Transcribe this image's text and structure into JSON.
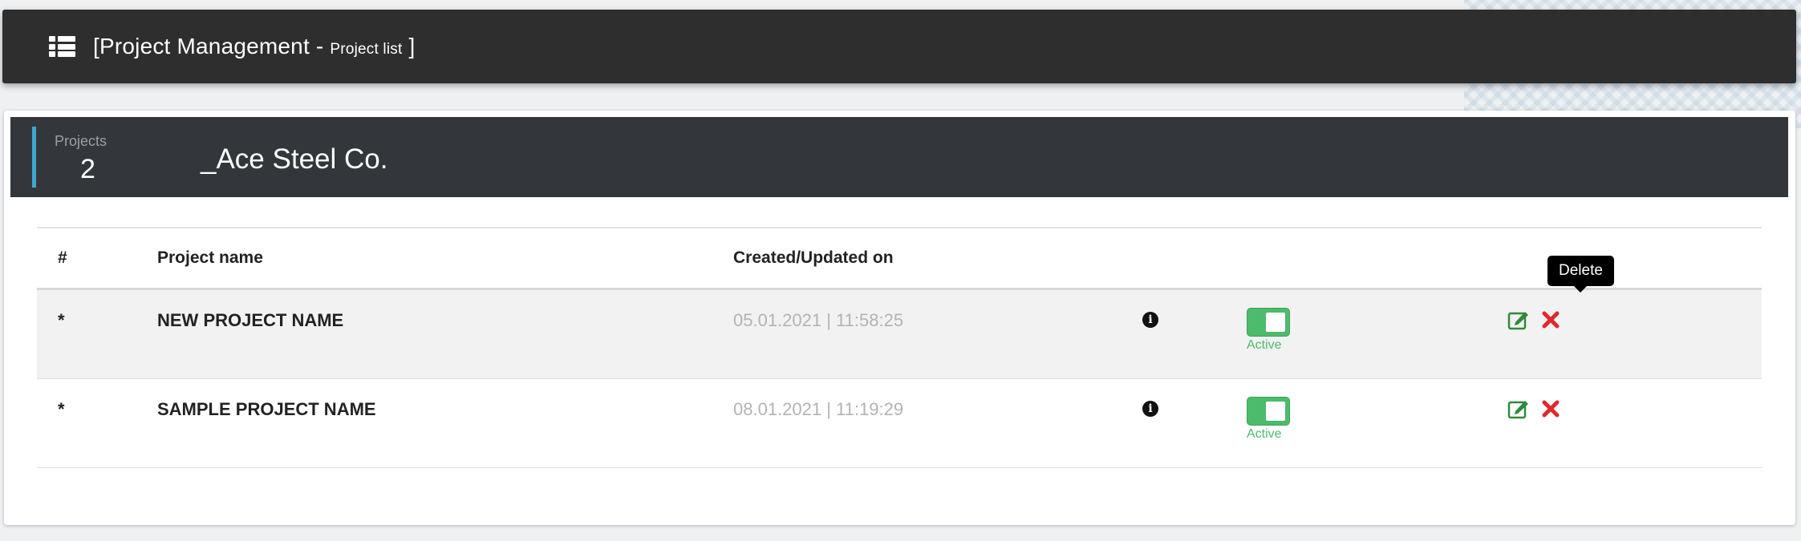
{
  "header": {
    "title_main": "[Project Management - ",
    "title_sub": "Project list",
    "title_end": " ]",
    "menu_icon": "list-icon"
  },
  "summary": {
    "count_label": "Projects",
    "count": "2",
    "company": "_Ace Steel Co."
  },
  "table": {
    "columns": [
      "#",
      "Project name",
      "Created/Updated on"
    ],
    "rows": [
      {
        "mark": "*",
        "name": "NEW PROJECT NAME",
        "date": "05.01.2021 | 11:58:25",
        "status": "Active"
      },
      {
        "mark": "*",
        "name": "SAMPLE PROJECT NAME",
        "date": "08.01.2021 | 11:19:29",
        "status": "Active"
      }
    ]
  },
  "tooltip": {
    "delete": "Delete"
  },
  "colors": {
    "header_bg": "#2e2e2e",
    "panel_head_bg": "#33373c",
    "accent": "#3fa7cc",
    "active_green": "#4cbb6c",
    "delete_red": "#e0282f",
    "edit_green": "#2e8b3a"
  }
}
